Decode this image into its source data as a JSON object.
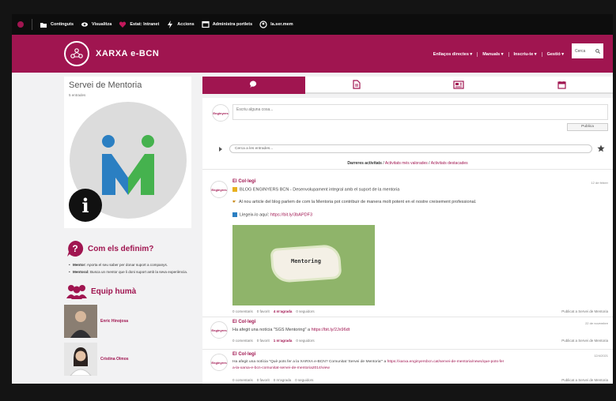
{
  "topbar": {
    "items": [
      {
        "icon": "folder-icon",
        "label": "Continguts"
      },
      {
        "icon": "eye-icon",
        "label": "Visualitza"
      },
      {
        "icon": "heart-icon",
        "label": "Estat: Intranet"
      },
      {
        "icon": "bolt-icon",
        "label": "Accions"
      },
      {
        "icon": "window-icon",
        "label": "Administra portlets"
      },
      {
        "icon": "user-icon",
        "label": "la.ser.mem"
      }
    ]
  },
  "header": {
    "brand": "XARXA e-BCN",
    "nav": [
      "Enllaços directes",
      "Manuals",
      "Inscriu-te",
      "Gestió"
    ],
    "search_placeholder": "Cerca"
  },
  "profile": {
    "title": "Servei de Mentoria",
    "subtitle": "5 entrades",
    "info_glyph": "i",
    "logo_letter": "M"
  },
  "definitions": {
    "title": "Com els definim?",
    "items": [
      {
        "term": "Mentor:",
        "text": "Aporta el seu saber per donar suport a companys."
      },
      {
        "term": "Mentoral:",
        "text": "Busca un mentor que li doni suport amb la seva experiència."
      }
    ]
  },
  "team": {
    "title": "Equip humà",
    "members": [
      "Enric Hinojosa",
      "Cristina Olmos"
    ]
  },
  "composer": {
    "placeholder": "Escriu alguna cosa...",
    "publish": "Publica",
    "mini_logo": "Enginyers",
    "search_placeholder": "Cerca a les entrades..."
  },
  "filters": {
    "current": "Darreres activitats",
    "links": [
      "Activitats més valorades",
      "Activitats destacades"
    ]
  },
  "posts": [
    {
      "author": "El Col·legi",
      "date": "12 de febrer",
      "lines": [
        {
          "text": "BLOG ENGINYERS BCN - Desenvolupament integral amb el suport de la mentoria",
          "url": ""
        },
        {
          "text": "Al nou article del blog parlem de com la Mentoria pot contribuir de manera molt potent en el nostre creixement professional.",
          "url": ""
        },
        {
          "text": "Llegeix-lo aquí:",
          "url": "https://bit.ly/3bAPDF3"
        }
      ],
      "image_text": "Mentoring",
      "actions": [
        "0 comentaris",
        "0 favorit",
        "4 m'agrada",
        "0 seguidors"
      ],
      "destination": "Publicat a Servei de Mentoria"
    },
    {
      "author": "El Col·legi",
      "date": "22 de novembre",
      "lines": [
        {
          "text": "Ha afegit una notícia \"SGS Mentoring\" a",
          "url": "https://bit.ly/2Jx96dt"
        }
      ],
      "actions": [
        "0 comentaris",
        "0 favorit",
        "1 m'agrada",
        "0 seguidors"
      ],
      "destination": "Publicat a Servei de Mentoria"
    },
    {
      "author": "El Col·legi",
      "date": "12/4/2021",
      "lines": [
        {
          "text": "Ha afegit una notícia \"Què pots fer a la XARXA e-BCN? Comunitat 'Servei de Mentoria'\" a",
          "url": "https://xarxa.enginyersbcn.cat/servei-de-mentoria/news/que-pots-fer"
        },
        {
          "text": "a-la-xarxa-e-bcn-comunitat-servei-de-mentoria2014/view",
          "url": ""
        }
      ],
      "actions": [
        "0 comentaris",
        "0 favorit",
        "0 m'agrada",
        "0 seguidors"
      ],
      "destination": "Publicat a Servei de Mentoria"
    }
  ],
  "colors": {
    "brand": "#a01550",
    "logo_blue": "#2b7fc2",
    "logo_green": "#45b24e"
  }
}
